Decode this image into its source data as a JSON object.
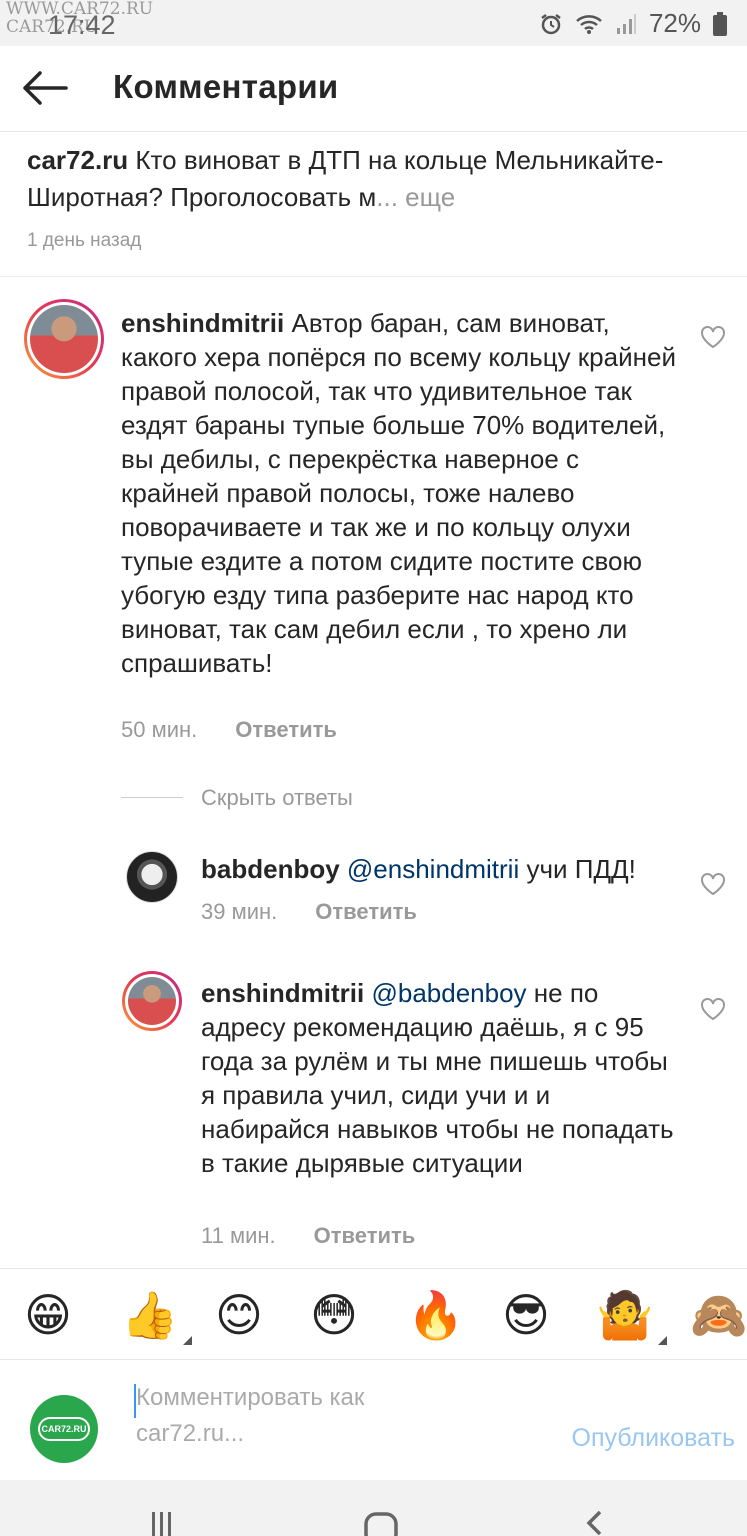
{
  "status": {
    "watermark_top": "WWW.CAR72.RU",
    "watermark_bottom": "CAR72.RU",
    "time": "17:42",
    "battery": "72%"
  },
  "header": {
    "title": "Комментарии"
  },
  "caption": {
    "user": "car72.ru",
    "text": " Кто виноват в ДТП на кольце Мельникайте-Широтная? Проголосовать м",
    "ellipsis": "... ",
    "more": "еще",
    "time": "1 день назад"
  },
  "comments": [
    {
      "user": "enshindmitrii",
      "text": " Автор баран, сам виноват, какого хера попёрся по всему кольцу крайней правой полосой, так что удивительное так ездят бараны тупые больше 70% водителей, вы дебилы, с перекрёстка наверное с крайней правой полосы, тоже налево поворачиваете и так же и по кольцу олухи тупые ездите а потом сидите постите свою убогую езду типа разберите нас народ кто виноват, так сам дебил если , то хрено ли спрашивать!",
      "time": "50 мин.",
      "reply": "Ответить"
    }
  ],
  "hide_replies": "Скрыть ответы",
  "replies": [
    {
      "user": "babdenboy",
      "mention": " @enshindmitrii",
      "text": " учи ПДД!",
      "time": "39 мин.",
      "reply": "Ответить"
    },
    {
      "user": "enshindmitrii",
      "mention": " @babdenboy",
      "text": " не по адресу рекомендацию даёшь, я с 95 года за рулём и ты мне пишешь чтобы я правила учил, сиди учи и и набирайся навыков чтобы не попадать в такие дырявые ситуации",
      "time": "11 мин.",
      "reply": "Ответить"
    }
  ],
  "emojis": [
    "😁",
    "👍",
    "😊",
    "😳",
    "🔥",
    "😎",
    "🤷",
    "🙈"
  ],
  "compose": {
    "placeholder_line1": "Комментировать как",
    "placeholder_line2": "car72.ru...",
    "publish": "Опубликовать",
    "avatar_text": "CAR72.RU"
  }
}
